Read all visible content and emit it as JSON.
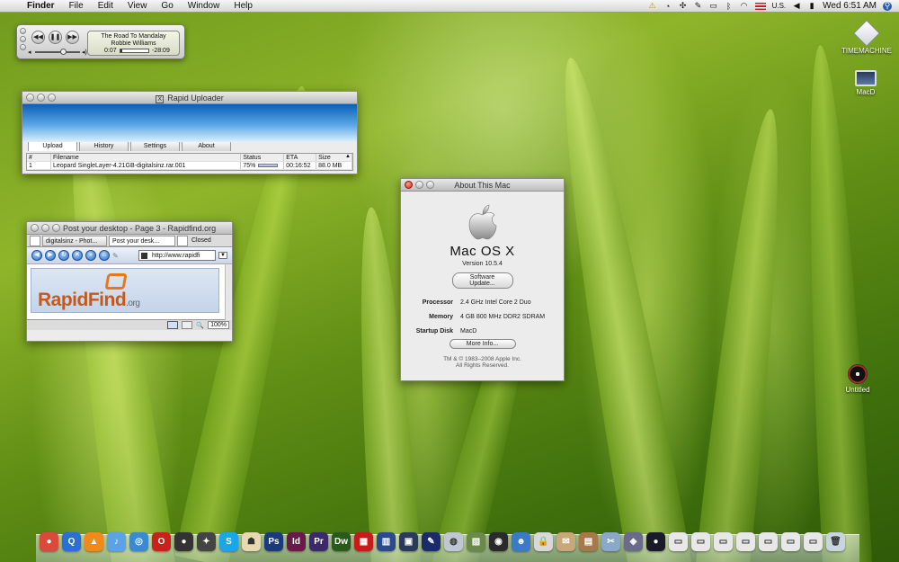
{
  "menubar": {
    "app_name": "Finder",
    "menus": [
      "File",
      "Edit",
      "View",
      "Go",
      "Window",
      "Help"
    ],
    "input_locale": "U.S.",
    "clock": "Wed 6:51 AM"
  },
  "itunes": {
    "song": "The Road To Mandalay",
    "artist": "Robbie Williams",
    "elapsed": "0:07",
    "remaining": "-28:09",
    "progress_fraction": 0.06
  },
  "uploader": {
    "title": "Rapid Uploader",
    "tabs": [
      "Upload",
      "History",
      "Settings",
      "About"
    ],
    "columns": [
      "#",
      "Filename",
      "Status",
      "ETA",
      "Size"
    ],
    "rows": [
      {
        "num": "1",
        "filename": "Leopard SingleLayer-4.21GB-digitalsinz.rar.001",
        "status": "75%",
        "eta": "00:16:52",
        "size": "88.0 MB"
      }
    ]
  },
  "browser": {
    "title": "Post your desktop - Page 3 - Rapidfind.org",
    "tabs": [
      "digitalsinz - Phot...",
      "Post your desk..."
    ],
    "closed_label": "Closed",
    "url": "http://www.rapidfi",
    "logo_main": "RapidFind",
    "logo_tld": ".org",
    "zoom": "100%"
  },
  "about": {
    "title": "About This Mac",
    "os_name": "Mac OS X",
    "version": "Version 10.5.4",
    "software_update": "Software Update...",
    "specs": [
      {
        "label": "Processor",
        "value": "2.4 GHz Intel Core 2 Duo"
      },
      {
        "label": "Memory",
        "value": "4 GB 800 MHz DDR2 SDRAM"
      },
      {
        "label": "Startup Disk",
        "value": "MacD"
      }
    ],
    "more_info": "More Info...",
    "copyright_1": "TM & © 1983–2008 Apple Inc.",
    "copyright_2": "All Rights Reserved."
  },
  "desktop_icons": [
    "TIMEMACHINE",
    "MacD",
    "Untitled"
  ],
  "dock": [
    {
      "icon": "picasa-icon",
      "color": "#d94a3a",
      "glyph": "●"
    },
    {
      "icon": "quicktime-icon",
      "color": "#2a6fd6",
      "glyph": "Q"
    },
    {
      "icon": "vlc-icon",
      "color": "#f08a1c",
      "glyph": "▲"
    },
    {
      "icon": "itunes-icon",
      "color": "#5aa3e6",
      "glyph": "♪"
    },
    {
      "icon": "safari-icon",
      "color": "#3a8ad0",
      "glyph": "◎"
    },
    {
      "icon": "opera-icon",
      "color": "#c8201a",
      "glyph": "O"
    },
    {
      "icon": "camera-icon",
      "color": "#333333",
      "glyph": "●"
    },
    {
      "icon": "games-icon",
      "color": "#444444",
      "glyph": "✦"
    },
    {
      "icon": "skype-icon",
      "color": "#1aa7e8",
      "glyph": "S"
    },
    {
      "icon": "app-icon",
      "color": "#e8d9b0",
      "glyph": "☗"
    },
    {
      "icon": "photoshop-icon",
      "color": "#1b3a7a",
      "glyph": "Ps"
    },
    {
      "icon": "indesign-icon",
      "color": "#6a1a4a",
      "glyph": "Id"
    },
    {
      "icon": "premiere-icon",
      "color": "#3a2a6a",
      "glyph": "Pr"
    },
    {
      "icon": "dreamweaver-icon",
      "color": "#2a5a1a",
      "glyph": "Dw"
    },
    {
      "icon": "calendar-icon",
      "color": "#c81a1a",
      "glyph": "▦"
    },
    {
      "icon": "spaces-icon",
      "color": "#2a4a8a",
      "glyph": "▥"
    },
    {
      "icon": "expose-icon",
      "color": "#2a3a5a",
      "glyph": "▣"
    },
    {
      "icon": "pen-icon",
      "color": "#1a2a6a",
      "glyph": "✎"
    },
    {
      "icon": "globe-icon",
      "color": "#bfc8d0",
      "glyph": "◍"
    },
    {
      "icon": "preview-icon",
      "color": "#6a8a4a",
      "glyph": "▧"
    },
    {
      "icon": "dashboard-icon",
      "color": "#2a2a2a",
      "glyph": "◉"
    },
    {
      "icon": "people-icon",
      "color": "#3a7ac8",
      "glyph": "☻"
    },
    {
      "icon": "lock-icon",
      "color": "#d8d8d8",
      "glyph": "🔒"
    },
    {
      "icon": "stamp-icon",
      "color": "#c8a878",
      "glyph": "✉"
    },
    {
      "icon": "chest-icon",
      "color": "#a87848",
      "glyph": "▤"
    },
    {
      "icon": "tools-icon",
      "color": "#8aa8c8",
      "glyph": "✂"
    },
    {
      "icon": "stack-icon",
      "color": "#6a6a8a",
      "glyph": "◈"
    },
    {
      "icon": "orb-icon",
      "color": "#1a1a2a",
      "glyph": "●"
    },
    {
      "icon": "window1-icon",
      "color": "#e8e8e8",
      "glyph": "▭"
    },
    {
      "icon": "window2-icon",
      "color": "#e8e8e8",
      "glyph": "▭"
    },
    {
      "icon": "window3-icon",
      "color": "#e8e8e8",
      "glyph": "▭"
    },
    {
      "icon": "window4-icon",
      "color": "#e8e8e8",
      "glyph": "▭"
    },
    {
      "icon": "window5-icon",
      "color": "#e8e8e8",
      "glyph": "▭"
    },
    {
      "icon": "window6-icon",
      "color": "#e8e8e8",
      "glyph": "▭"
    },
    {
      "icon": "window7-icon",
      "color": "#e8e8e8",
      "glyph": "▭"
    },
    {
      "icon": "trash-icon",
      "color": "#c8d4e0",
      "glyph": "🗑"
    }
  ]
}
